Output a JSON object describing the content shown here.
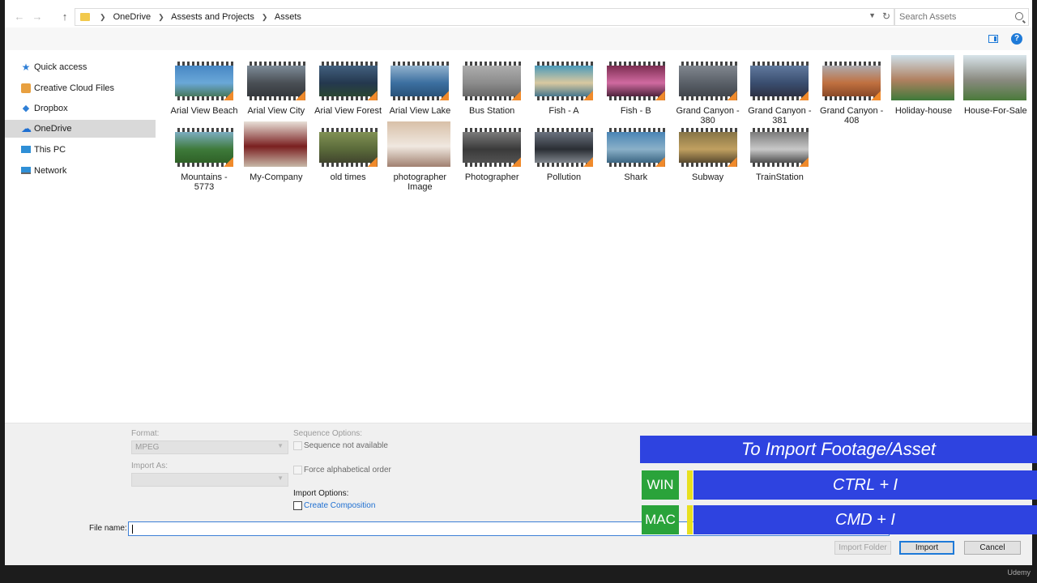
{
  "address": {
    "crumbs": [
      "OneDrive",
      "Assests and Projects",
      "Assets"
    ],
    "search_placeholder": "Search Assets"
  },
  "nav": [
    {
      "label": "Quick access",
      "icon": "star-icon"
    },
    {
      "label": "Creative Cloud Files",
      "icon": "creative-cloud-icon"
    },
    {
      "label": "Dropbox",
      "icon": "dropbox-icon"
    },
    {
      "label": "OneDrive",
      "icon": "onedrive-icon",
      "selected": true
    },
    {
      "label": "This PC",
      "icon": "pc-icon"
    },
    {
      "label": "Network",
      "icon": "network-icon"
    }
  ],
  "files": [
    {
      "name": "Arial View Beach",
      "kind": "video",
      "colors": [
        "#3f7fbf",
        "#6aa8d8",
        "#3e6b3a"
      ]
    },
    {
      "name": "Arial View City",
      "kind": "video",
      "colors": [
        "#8a9aa8",
        "#4a4f55",
        "#2e3236"
      ]
    },
    {
      "name": "Arial View Forest",
      "kind": "video",
      "colors": [
        "#4a6a8a",
        "#24384f",
        "#2c4a2a"
      ]
    },
    {
      "name": "Arial View Lake",
      "kind": "video",
      "colors": [
        "#a7c2d8",
        "#3c6fa0",
        "#234a6e"
      ]
    },
    {
      "name": "Bus Station",
      "kind": "video",
      "colors": [
        "#b5b5b5",
        "#8c8c8c",
        "#5d5d5d"
      ]
    },
    {
      "name": "Fish - A",
      "kind": "video",
      "colors": [
        "#2a8fc0",
        "#d9c9a0",
        "#1c5e86"
      ]
    },
    {
      "name": "Fish - B",
      "kind": "video",
      "colors": [
        "#6a2040",
        "#d06aa0",
        "#2a1020"
      ]
    },
    {
      "name": "Grand Canyon - 380",
      "kind": "video",
      "colors": [
        "#8a9098",
        "#5a6068",
        "#3a3e44"
      ]
    },
    {
      "name": "Grand Canyon - 381",
      "kind": "video",
      "colors": [
        "#6a84a8",
        "#3a4e70",
        "#2a2a38"
      ]
    },
    {
      "name": "Grand Canyon - 408",
      "kind": "video",
      "colors": [
        "#a8b8c8",
        "#c07040",
        "#7a3e20"
      ]
    },
    {
      "name": "Holiday-house",
      "kind": "photo",
      "colors": [
        "#cfe0ea",
        "#b08060",
        "#3e7a3a"
      ]
    },
    {
      "name": "House-For-Sale",
      "kind": "photo",
      "colors": [
        "#d8e4ea",
        "#8a8a80",
        "#4a7a3a"
      ]
    },
    {
      "name": "Mountains - 5773",
      "kind": "video",
      "colors": [
        "#8ab8e0",
        "#3e7a3a",
        "#2a5a22"
      ]
    },
    {
      "name": "My-Company",
      "kind": "photo",
      "colors": [
        "#e8e0d8",
        "#7a2020",
        "#c8b8a8"
      ]
    },
    {
      "name": "old times",
      "kind": "video",
      "colors": [
        "#8a9a5a",
        "#5a6a3a",
        "#3a3a2a"
      ]
    },
    {
      "name": "photographer Image",
      "kind": "photo",
      "colors": [
        "#d8c0a8",
        "#f0e8e0",
        "#a08070"
      ]
    },
    {
      "name": "Photographer",
      "kind": "video",
      "colors": [
        "#8a8a8a",
        "#3a3a3a",
        "#5a5a5a"
      ]
    },
    {
      "name": "Pollution",
      "kind": "video",
      "colors": [
        "#7a8290",
        "#2a2e34",
        "#9aa0a8"
      ]
    },
    {
      "name": "Shark",
      "kind": "video",
      "colors": [
        "#3a7ab0",
        "#8ab0c8",
        "#24506e"
      ]
    },
    {
      "name": "Subway",
      "kind": "video",
      "colors": [
        "#7a6a40",
        "#c0a060",
        "#3a3020"
      ]
    },
    {
      "name": "TrainStation",
      "kind": "video",
      "colors": [
        "#6a6a6a",
        "#c8c8c8",
        "#2a2a2a"
      ]
    }
  ],
  "options": {
    "format_label": "Format:",
    "format_value": "MPEG",
    "import_as_label": "Import As:",
    "import_as_value": "",
    "sequence_label": "Sequence Options:",
    "sequence_check": "Sequence not available",
    "alpha_check": "Force alphabetical order",
    "import_options_label": "Import Options:",
    "create_comp": "Create Composition",
    "file_name_label": "File name:",
    "file_name_value": ""
  },
  "buttons": {
    "import_folder": "Import Folder",
    "import": "Import",
    "cancel": "Cancel"
  },
  "overlay": {
    "title": "To Import Footage/Asset",
    "win_label": "WIN",
    "win_combo": "CTRL + I",
    "mac_label": "MAC",
    "mac_combo": "CMD + I",
    "accent_blue": "#2e43e0",
    "accent_green": "#2aa33a",
    "accent_yellow": "#e8e020"
  },
  "watermark": "Udemy"
}
